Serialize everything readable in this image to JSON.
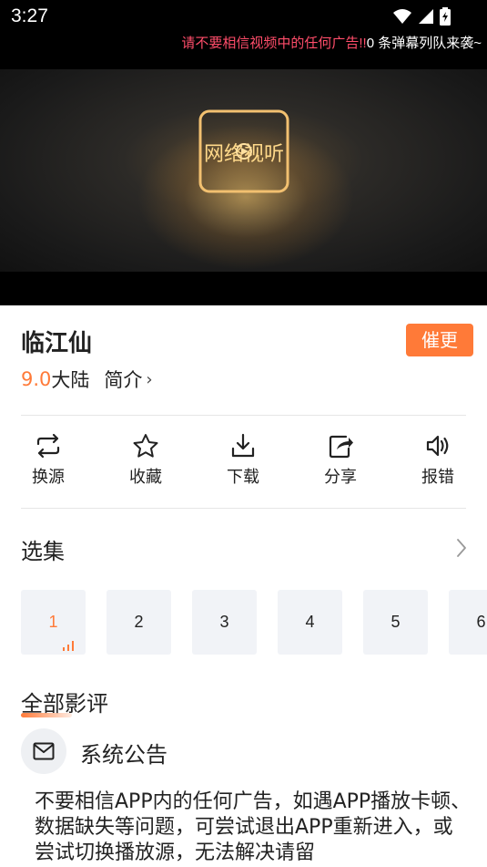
{
  "status_bar": {
    "time": "3:27"
  },
  "danmu": {
    "warning": "请不要相信视频中的任何广告!!",
    "count": "0 条弹幕列队来袭~",
    "warning_color": "#ff4d6a"
  },
  "video": {
    "logo_text": "网络视听"
  },
  "detail": {
    "title": "临江仙",
    "urge_label": "催更",
    "score": "9.0",
    "region": "大陆",
    "intro_label": "简介",
    "intro_chevron": "›",
    "accent_color": "#ff7a38"
  },
  "actions": [
    {
      "label": "换源",
      "icon": "switch-source-icon"
    },
    {
      "label": "收藏",
      "icon": "star-icon"
    },
    {
      "label": "下载",
      "icon": "download-icon"
    },
    {
      "label": "分享",
      "icon": "share-icon"
    },
    {
      "label": "报错",
      "icon": "speaker-icon"
    }
  ],
  "episodes": {
    "header": "选集",
    "items": [
      "1",
      "2",
      "3",
      "4",
      "5",
      "6"
    ],
    "active_index": 0
  },
  "reviews": {
    "title": "全部影评"
  },
  "notice": {
    "icon": "mail-icon",
    "title": "系统公告",
    "body": "不要相信APP内的任何广告，如遇APP播放卡顿、数据缺失等问题，可尝试退出APP重新进入，或尝试切换播放源，无法解决请留"
  }
}
